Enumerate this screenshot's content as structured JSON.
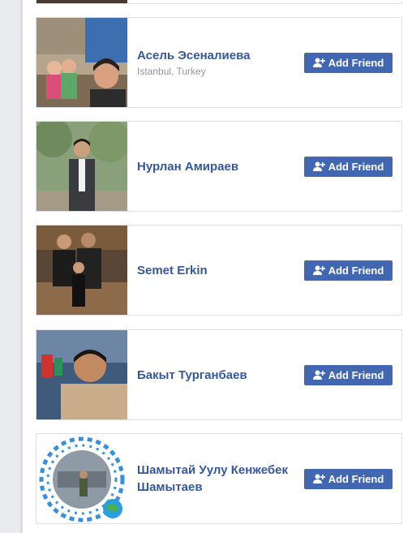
{
  "people": [
    {
      "name": "Асель Эсеналиева",
      "location": "Istanbul, Turkey",
      "button": "Add Friend",
      "icon": "add-friend-icon"
    },
    {
      "name": "Нурлан Амираев",
      "location": "",
      "button": "Add Friend",
      "icon": "add-friend-icon"
    },
    {
      "name": "Semet Erkin",
      "location": "",
      "button": "Add Friend",
      "icon": "add-friend-icon"
    },
    {
      "name": "Бакыт Турганбаев",
      "location": "",
      "button": "Add Friend",
      "icon": "add-friend-icon"
    },
    {
      "name": "Шамытай Уулу Кенжебек Шамытаев",
      "location": "",
      "button": "Add Friend",
      "icon": "add-friend-icon"
    }
  ],
  "colors": {
    "link": "#365899",
    "button": "#4267b2",
    "secondary": "#90949c"
  }
}
